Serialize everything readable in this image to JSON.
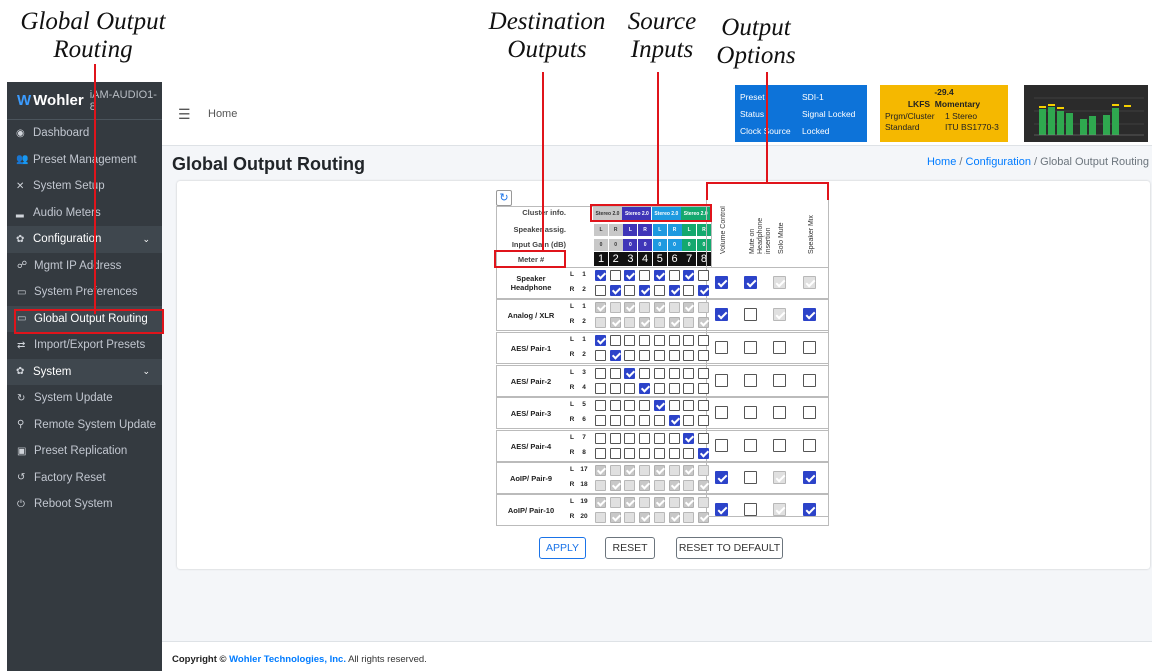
{
  "annotations": {
    "global_output_routing": "Global Output\nRouting",
    "destination_outputs": "Destination\nOutputs",
    "source_inputs": "Source\nInputs",
    "output_options": "Output\nOptions"
  },
  "app": {
    "brand": "Wohler",
    "model": "iAM-AUDIO1-8"
  },
  "sidebar": {
    "items": [
      {
        "icon": "dashboard-icon",
        "label": "Dashboard"
      },
      {
        "icon": "users-icon",
        "label": "Preset Management"
      },
      {
        "icon": "tools-icon",
        "label": "System Setup"
      },
      {
        "icon": "chart-icon",
        "label": "Audio Meters"
      },
      {
        "icon": "gear-icon",
        "label": "Configuration"
      },
      {
        "icon": "network-icon",
        "label": "Mgmt IP Address"
      },
      {
        "icon": "hdd-icon",
        "label": "System Preferences"
      },
      {
        "icon": "hdd-icon",
        "label": "Global Output Routing"
      },
      {
        "icon": "exchange-icon",
        "label": "Import/Export Presets"
      },
      {
        "icon": "gears-icon",
        "label": "System"
      },
      {
        "icon": "sync-icon",
        "label": "System Update"
      },
      {
        "icon": "satellite-icon",
        "label": "Remote System Update"
      },
      {
        "icon": "copy-icon",
        "label": "Preset Replication"
      },
      {
        "icon": "undo-icon",
        "label": "Factory Reset"
      },
      {
        "icon": "power-icon",
        "label": "Reboot System"
      }
    ]
  },
  "topbar": {
    "home": "Home"
  },
  "status": {
    "preset_label": "Preset",
    "preset_value": "SDI-1",
    "status_label": "Status",
    "status_value": "Signal Locked",
    "clock_label": "Clock Source",
    "clock_value": "Locked"
  },
  "loudness": {
    "value": "-29.4",
    "unit": "LKFS",
    "mode": "Momentary",
    "cluster_label": "Prgm/Cluster",
    "cluster_value": "1  Stereo",
    "standard_label": "Standard",
    "standard_value": "ITU BS1770-3"
  },
  "page": {
    "title": "Global Output Routing",
    "crumb_home": "Home",
    "crumb_config": "Configuration",
    "crumb_current": "Global Output Routing",
    "sep": "/"
  },
  "routing": {
    "row_labels": {
      "cluster_info": "Cluster info.",
      "speaker_assig": "Speaker assig.",
      "input_gain": "Input Gain (dB)",
      "meter": "Meter #"
    },
    "clusters": [
      "Stereo 2.0",
      "Stereo 2.0",
      "Stereo 2.0",
      "Stereo 2.0"
    ],
    "cluster_colors": [
      "#c8c8c8",
      "#3f35b8",
      "#1e9ae0",
      "#14a86e"
    ],
    "speakers": [
      "L",
      "R",
      "L",
      "R",
      "L",
      "R",
      "L",
      "R"
    ],
    "gains": [
      "0",
      "0",
      "0",
      "0",
      "0",
      "0",
      "0",
      "0"
    ],
    "meters": [
      "1",
      "2",
      "3",
      "4",
      "5",
      "6",
      "7",
      "8"
    ],
    "option_headers": [
      "Volume Control",
      "Mute on Headphone insertion",
      "Solo Mute",
      "Speaker Mix"
    ],
    "outputs": [
      {
        "name": "Speaker Headphone",
        "ch": [
          [
            "L",
            "1"
          ],
          [
            "R",
            "2"
          ]
        ],
        "disabled": false,
        "grid": [
          [
            1,
            0,
            1,
            0,
            1,
            0,
            1,
            0
          ],
          [
            0,
            1,
            0,
            1,
            0,
            1,
            0,
            1
          ]
        ],
        "opts": [
          "on",
          "on",
          "dis",
          "dis"
        ]
      },
      {
        "name": "Analog / XLR",
        "ch": [
          [
            "L",
            "1"
          ],
          [
            "R",
            "2"
          ]
        ],
        "disabled": true,
        "grid": [
          [
            1,
            0,
            1,
            0,
            1,
            0,
            1,
            0
          ],
          [
            0,
            1,
            0,
            1,
            0,
            1,
            0,
            1
          ]
        ],
        "opts": [
          "on",
          "off",
          "dis",
          "on"
        ]
      },
      {
        "name": "AES/ Pair-1",
        "ch": [
          [
            "L",
            "1"
          ],
          [
            "R",
            "2"
          ]
        ],
        "disabled": false,
        "grid": [
          [
            1,
            0,
            0,
            0,
            0,
            0,
            0,
            0
          ],
          [
            0,
            1,
            0,
            0,
            0,
            0,
            0,
            0
          ]
        ],
        "opts": [
          "off",
          "off",
          "off",
          "off"
        ]
      },
      {
        "name": "AES/ Pair-2",
        "ch": [
          [
            "L",
            "3"
          ],
          [
            "R",
            "4"
          ]
        ],
        "disabled": false,
        "grid": [
          [
            0,
            0,
            1,
            0,
            0,
            0,
            0,
            0
          ],
          [
            0,
            0,
            0,
            1,
            0,
            0,
            0,
            0
          ]
        ],
        "opts": [
          "off",
          "off",
          "off",
          "off"
        ]
      },
      {
        "name": "AES/ Pair-3",
        "ch": [
          [
            "L",
            "5"
          ],
          [
            "R",
            "6"
          ]
        ],
        "disabled": false,
        "grid": [
          [
            0,
            0,
            0,
            0,
            1,
            0,
            0,
            0
          ],
          [
            0,
            0,
            0,
            0,
            0,
            1,
            0,
            0
          ]
        ],
        "opts": [
          "off",
          "off",
          "off",
          "off"
        ]
      },
      {
        "name": "AES/ Pair-4",
        "ch": [
          [
            "L",
            "7"
          ],
          [
            "R",
            "8"
          ]
        ],
        "disabled": false,
        "grid": [
          [
            0,
            0,
            0,
            0,
            0,
            0,
            1,
            0
          ],
          [
            0,
            0,
            0,
            0,
            0,
            0,
            0,
            1
          ]
        ],
        "opts": [
          "off",
          "off",
          "off",
          "off"
        ]
      },
      {
        "name": "AoIP/ Pair-9",
        "ch": [
          [
            "L",
            "17"
          ],
          [
            "R",
            "18"
          ]
        ],
        "disabled": true,
        "grid": [
          [
            1,
            0,
            1,
            0,
            1,
            0,
            1,
            0
          ],
          [
            0,
            1,
            0,
            1,
            0,
            1,
            0,
            1
          ]
        ],
        "opts": [
          "on",
          "off",
          "dis",
          "on"
        ]
      },
      {
        "name": "AoIP/ Pair-10",
        "ch": [
          [
            "L",
            "19"
          ],
          [
            "R",
            "20"
          ]
        ],
        "disabled": true,
        "grid": [
          [
            1,
            0,
            1,
            0,
            1,
            0,
            1,
            0
          ],
          [
            0,
            1,
            0,
            1,
            0,
            1,
            0,
            1
          ]
        ],
        "opts": [
          "on",
          "off",
          "dis",
          "on"
        ]
      }
    ]
  },
  "buttons": {
    "apply": "APPLY",
    "reset": "RESET",
    "reset_default": "RESET TO DEFAULT"
  },
  "footer": {
    "prefix": "Copyright ©",
    "company": "Wohler Technologies, Inc.",
    "suffix": "All rights reserved."
  }
}
